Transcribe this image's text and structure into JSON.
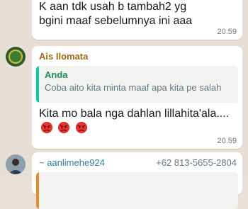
{
  "messages": [
    {
      "text": "K aan tdk usah b tambah2 yg\nbgini maaf sebelumnya ini aaa",
      "time": "20.59"
    },
    {
      "sender": "Ais Ilomata",
      "reply": {
        "name": "Anda",
        "text": "Coba aito kita minta maaf apa kita pe salah"
      },
      "text": "Kita mo bala nga dahlan lillahita'ala....",
      "emojis": [
        "angry-face-icon",
        "angry-face-icon",
        "angry-face-icon"
      ],
      "time": "20.59"
    },
    {
      "sender": "~ aanlimehe924",
      "phone": "+62 813-5655-2804"
    }
  ],
  "colors": {
    "wallpaper": "#e7dfd5",
    "bubble": "#ffffff",
    "sender1": "#a26a12",
    "reply_name": "#1f8f55",
    "reply_bar": "#06cf9c",
    "sender2": "#2d7fa0"
  }
}
